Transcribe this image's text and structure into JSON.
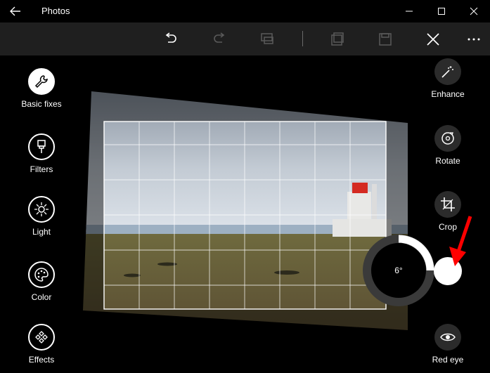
{
  "app": {
    "title": "Photos"
  },
  "left_panel": {
    "items": [
      {
        "label": "Basic fixes",
        "icon": "wrench-icon",
        "active": true
      },
      {
        "label": "Filters",
        "icon": "brush-icon"
      },
      {
        "label": "Light",
        "icon": "sun-icon"
      },
      {
        "label": "Color",
        "icon": "palette-icon"
      },
      {
        "label": "Effects",
        "icon": "effects-icon"
      }
    ]
  },
  "right_panel": {
    "items": [
      {
        "label": "Enhance",
        "icon": "magic-wand-icon"
      },
      {
        "label": "Rotate",
        "icon": "rotate-icon"
      },
      {
        "label": "Crop",
        "icon": "crop-icon"
      },
      {
        "label": "Red eye",
        "icon": "eye-icon"
      }
    ]
  },
  "rotation_dial": {
    "value": "6°"
  },
  "colors": {
    "background": "#000000",
    "toolbar": "#1f1f1f",
    "annotation_arrow": "#ff0000"
  }
}
